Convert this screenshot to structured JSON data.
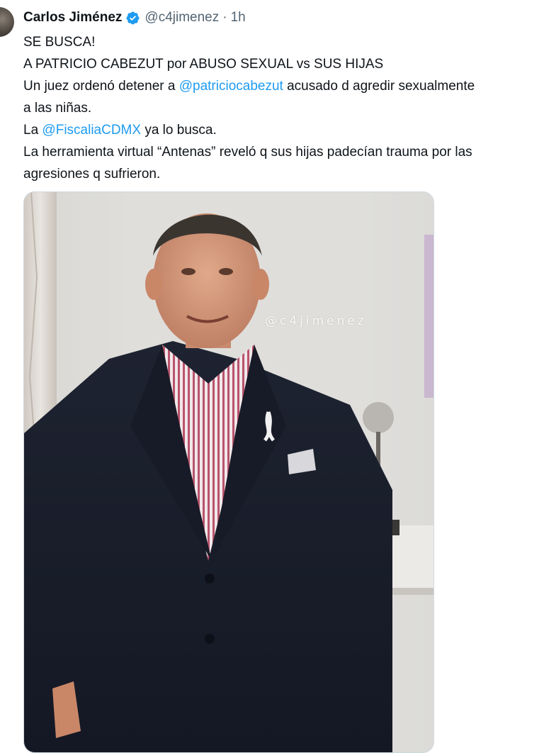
{
  "tweet": {
    "author": {
      "display_name": "Carlos Jiménez",
      "handle": "@c4jimenez",
      "separator": "·",
      "time": "1h",
      "verified": true
    },
    "lines": [
      {
        "text": "SE BUSCA!"
      },
      {
        "text": "A PATRICIO CABEZUT por ABUSO SEXUAL vs SUS HIJAS"
      },
      {
        "before": "Un juez ordenó detener a ",
        "mention": "@patriciocabezut",
        "after": " acusado d agredir sexualmente"
      },
      {
        "text": "a las niñas."
      },
      {
        "before": "La ",
        "mention": "@FiscaliaCDMX",
        "after": " ya lo busca."
      },
      {
        "text": "La herramienta virtual “Antenas” reveló q sus hijas padecían trauma por las"
      },
      {
        "text": "agresiones q sufrieron."
      }
    ],
    "media": {
      "watermark": "@c4jimenez"
    }
  },
  "colors": {
    "link": "#1d9bf0",
    "secondary_text": "#536471",
    "verified_badge": "#1d9bf0"
  }
}
